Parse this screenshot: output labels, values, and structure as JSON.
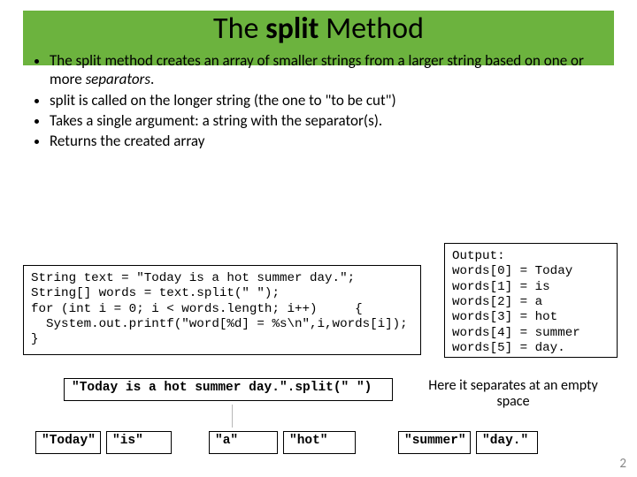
{
  "title": {
    "pre": "The ",
    "bold": "split",
    "post": " Method"
  },
  "bullets": [
    {
      "pre": "The ",
      "bold": "split",
      "post1": " method creates an array of smaller strings from a larger string based on one or more ",
      "ital": "separators",
      "post2": "."
    },
    {
      "text": "split is called on the longer string (the one to \"to be cut\")"
    },
    {
      "text": "Takes a single argument: a string with the separator(s)."
    },
    {
      "text": "Returns the created array"
    }
  ],
  "code_left": "String text = \"Today is a hot summer day.\";\nString[] words = text.split(\" \");\nfor (int i = 0; i < words.length; i++)     {\n  System.out.printf(\"word[%d] = %s\\n\",i,words[i]);\n}",
  "code_right": "Output:\nwords[0] = Today\nwords[1] = is\nwords[2] = a\nwords[3] = hot\nwords[4] = summer\nwords[5] = day.",
  "expr": "\"Today is a hot summer day.\".split(\" \")",
  "sep_note": "Here it separates at an empty space",
  "tokens": [
    "\"Today\"",
    "\"is\"",
    "\"a\"",
    "\"hot\"",
    "\"summer\"",
    "\"day.\""
  ],
  "page": "2"
}
